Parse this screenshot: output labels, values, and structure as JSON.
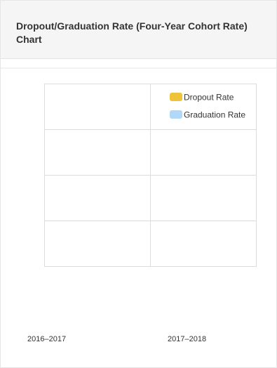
{
  "card": {
    "title": "Dropout/Graduation Rate (Four-Year Cohort Rate) Chart"
  },
  "chart_data": {
    "type": "bar",
    "title": "Dropout/Graduation Rate (Four-Year Cohort Rate) Chart",
    "categories": [
      "2016–2017",
      "2017–2018"
    ],
    "series": [
      {
        "name": "Dropout Rate",
        "color": "#eec239",
        "values": [
          null,
          null
        ]
      },
      {
        "name": "Graduation Rate",
        "color": "#b2d8f7",
        "values": [
          null,
          null
        ]
      }
    ],
    "grid": true,
    "legend": "top-right"
  }
}
